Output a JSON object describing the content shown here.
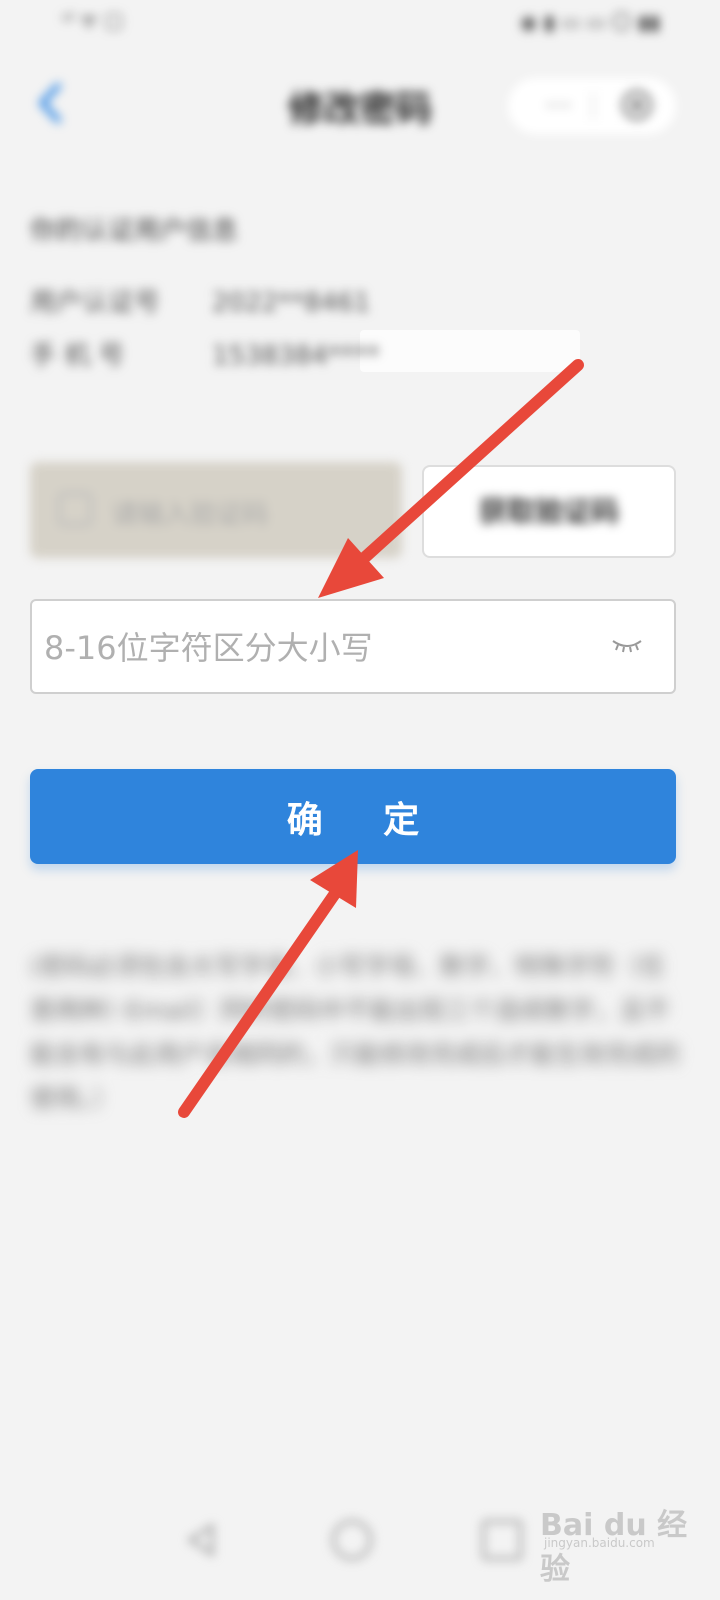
{
  "status_bar": {
    "left_text": "ᵘˡ ᯤ ▢",
    "right_text": "◉ ▮ ▭ ▭ 〇 ▮▮"
  },
  "header": {
    "title": "修改密码",
    "more_icon": "···",
    "back_icon": "chevron-left-icon",
    "close_icon": "target-close-icon"
  },
  "info": {
    "title": "你的认证用户信息",
    "id_label": "用户认证号",
    "id_value": "2022**8461",
    "phone_label": "手 机 号",
    "phone_value": "1538384****"
  },
  "verify": {
    "placeholder": "请输入验证码",
    "get_code_label": "获取验证码"
  },
  "password": {
    "placeholder": "8-16位字符区分大小写",
    "eye_icon": "eye-closed-icon"
  },
  "confirm": {
    "label": "确 定"
  },
  "description": "(密码必须包含大写字母、小写字母、数字、特殊字符（任意两种）·Email）同时密码中不能出现三个连续数字，且不能含有与此用户名相同的，只能修改完成后才能生效完成的使用。）",
  "watermark": {
    "text": "Bai du 经验",
    "url": "jingyan.baidu.com"
  },
  "colors": {
    "accent": "#2f84dc",
    "arrow": "#e8483a",
    "background": "#f3f3f3"
  }
}
